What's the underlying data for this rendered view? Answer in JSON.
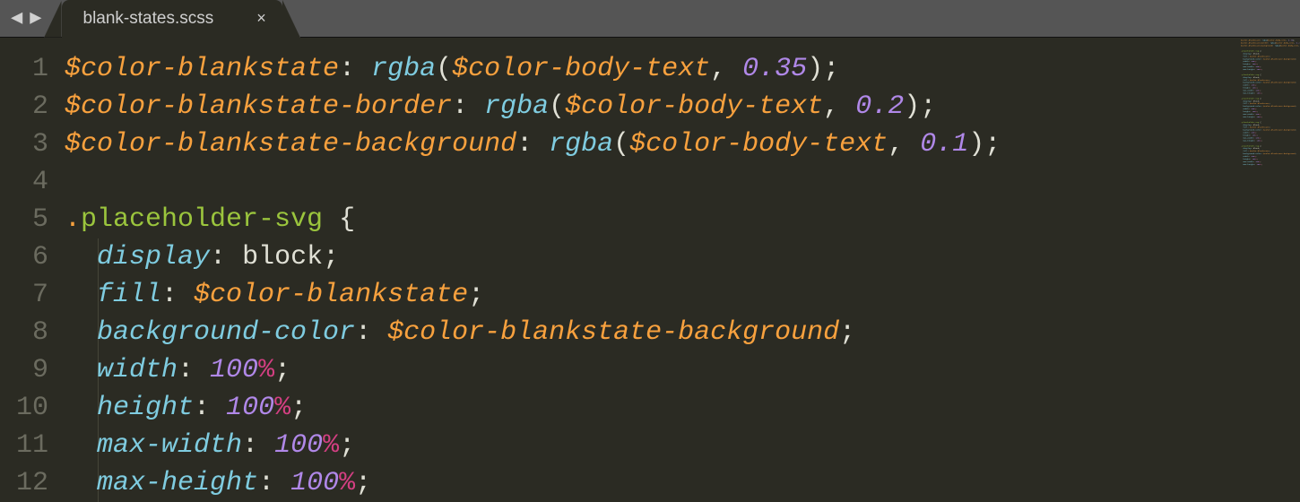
{
  "tab": {
    "filename": "blank-states.scss",
    "close_glyph": "×"
  },
  "nav": {
    "back": "◀",
    "forward": "▶"
  },
  "gutter_start": 1,
  "gutter_end": 12,
  "code_lines": [
    [
      {
        "c": "tok-var",
        "t": "$color-blankstate"
      },
      {
        "c": "tok-punct",
        "t": ": "
      },
      {
        "c": "tok-func",
        "t": "rgba"
      },
      {
        "c": "tok-punct",
        "t": "("
      },
      {
        "c": "tok-var",
        "t": "$color-body-text"
      },
      {
        "c": "tok-punct",
        "t": ", "
      },
      {
        "c": "tok-num",
        "t": "0.35"
      },
      {
        "c": "tok-punct",
        "t": ");"
      }
    ],
    [
      {
        "c": "tok-var",
        "t": "$color-blankstate-border"
      },
      {
        "c": "tok-punct",
        "t": ": "
      },
      {
        "c": "tok-func",
        "t": "rgba"
      },
      {
        "c": "tok-punct",
        "t": "("
      },
      {
        "c": "tok-var",
        "t": "$color-body-text"
      },
      {
        "c": "tok-punct",
        "t": ", "
      },
      {
        "c": "tok-num",
        "t": "0.2"
      },
      {
        "c": "tok-punct",
        "t": ");"
      }
    ],
    [
      {
        "c": "tok-var",
        "t": "$color-blankstate-background"
      },
      {
        "c": "tok-punct",
        "t": ": "
      },
      {
        "c": "tok-func",
        "t": "rgba"
      },
      {
        "c": "tok-punct",
        "t": "("
      },
      {
        "c": "tok-var",
        "t": "$color-body-text"
      },
      {
        "c": "tok-punct",
        "t": ", "
      },
      {
        "c": "tok-num",
        "t": "0.1"
      },
      {
        "c": "tok-punct",
        "t": ");"
      }
    ],
    [],
    [
      {
        "c": "tok-sel-dot",
        "t": "."
      },
      {
        "c": "tok-sel",
        "t": "placeholder-svg"
      },
      {
        "c": "tok-brace",
        "t": " {"
      }
    ],
    [
      {
        "indent": 2
      },
      {
        "c": "tok-prop",
        "t": "display"
      },
      {
        "c": "tok-punct",
        "t": ": "
      },
      {
        "c": "tok-val",
        "t": "block"
      },
      {
        "c": "tok-punct",
        "t": ";"
      }
    ],
    [
      {
        "indent": 2
      },
      {
        "c": "tok-prop",
        "t": "fill"
      },
      {
        "c": "tok-punct",
        "t": ": "
      },
      {
        "c": "tok-var",
        "t": "$color-blankstate"
      },
      {
        "c": "tok-punct",
        "t": ";"
      }
    ],
    [
      {
        "indent": 2
      },
      {
        "c": "tok-prop",
        "t": "background-color"
      },
      {
        "c": "tok-punct",
        "t": ": "
      },
      {
        "c": "tok-var",
        "t": "$color-blankstate-background"
      },
      {
        "c": "tok-punct",
        "t": ";"
      }
    ],
    [
      {
        "indent": 2
      },
      {
        "c": "tok-prop",
        "t": "width"
      },
      {
        "c": "tok-punct",
        "t": ": "
      },
      {
        "c": "tok-num",
        "t": "100"
      },
      {
        "c": "tok-unit",
        "t": "%"
      },
      {
        "c": "tok-punct",
        "t": ";"
      }
    ],
    [
      {
        "indent": 2
      },
      {
        "c": "tok-prop",
        "t": "height"
      },
      {
        "c": "tok-punct",
        "t": ": "
      },
      {
        "c": "tok-num",
        "t": "100"
      },
      {
        "c": "tok-unit",
        "t": "%"
      },
      {
        "c": "tok-punct",
        "t": ";"
      }
    ],
    [
      {
        "indent": 2
      },
      {
        "c": "tok-prop",
        "t": "max-width"
      },
      {
        "c": "tok-punct",
        "t": ": "
      },
      {
        "c": "tok-num",
        "t": "100"
      },
      {
        "c": "tok-unit",
        "t": "%"
      },
      {
        "c": "tok-punct",
        "t": ";"
      }
    ],
    [
      {
        "indent": 2
      },
      {
        "c": "tok-prop",
        "t": "max-height"
      },
      {
        "c": "tok-punct",
        "t": ": "
      },
      {
        "c": "tok-num",
        "t": "100"
      },
      {
        "c": "tok-unit",
        "t": "%"
      },
      {
        "c": "tok-punct",
        "t": ";"
      }
    ]
  ],
  "colors": {
    "background": "#2b2b23",
    "tab_bar": "#555555",
    "variable": "#f8a13e",
    "function": "#7fcce0",
    "number": "#b088e8",
    "selector": "#9bc53d",
    "property": "#7fcce0",
    "unit": "#d33f82",
    "default_text": "#e0e0d5",
    "gutter_text": "#6b6b5f"
  }
}
